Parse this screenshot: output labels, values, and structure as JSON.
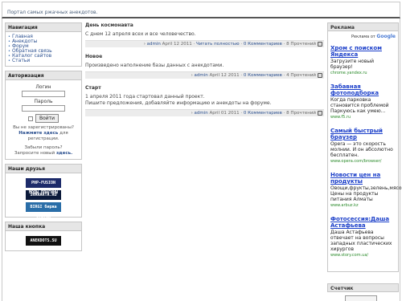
{
  "header": {
    "title": "Портал самых ржачных анекдотов."
  },
  "navigation": {
    "caption": "Навигация",
    "items": [
      "Главная",
      "Анекдоты",
      "Форум",
      "Обратная связь",
      "Каталог сайтов",
      "Статьи"
    ]
  },
  "auth": {
    "caption": "Авторизация",
    "login_label": "Логин",
    "password_label": "Пароль",
    "button": "Войти",
    "not_registered": "Вы не зарегистрированы?",
    "click_here": "Нажмите здесь",
    "for_registration": "для регистрации.",
    "forgot": "Забыли пароль?",
    "request_new": "Запросите новый",
    "here": "здесь."
  },
  "friends": {
    "caption": "Наши друзья",
    "banners": [
      "PHP-FUSION МОДЫ ПЛАГИНЫ",
      "SHARARTA.RU",
      "BIRGI биржа статей"
    ]
  },
  "our_button": {
    "caption": "Наша кнопка",
    "banner": "ANEKDOTS.SU"
  },
  "news": [
    {
      "title": "День космонавта",
      "text": "С днем 12 апреля всех и все человечество.",
      "author": "admin",
      "date": "April 12 2011",
      "read_more": "Читать полностью",
      "comments": "0 Комментариев",
      "reads": "8 Прочтений"
    },
    {
      "title": "Новое",
      "text": "Произведено наполнение базы данных с анекдотами.",
      "author": "admin",
      "date": "April 12 2011",
      "read_more": "",
      "comments": "0 Комментариев",
      "reads": "4 Прочтений"
    },
    {
      "title": "Старт",
      "text": "1 апреля 2011 года стартовал данный проект.",
      "text2": "Пишите предложения, добавляйте информацию и анекдоты на форуме.",
      "author": "admin",
      "date": "April 01 2011",
      "read_more": "",
      "comments": "0 Комментариев",
      "reads": "8 Прочтений"
    }
  ],
  "ads": {
    "caption": "Реклама",
    "ads_by": "Реклама от",
    "google": "Google",
    "items": [
      {
        "title": "Хром с поиском Яндекса",
        "text": "Загрузите новый браузер!",
        "url": "chrome.yandex.ru"
      },
      {
        "title": "Забавная фотоподборка",
        "text": "Когда парковка становится проблемой Паркуюсь как умею...",
        "url": "www.f5.ru"
      },
      {
        "title": "Самый быстрый браузер",
        "text": "Opera — это скорость молнии. И он абсолютно бесплатен.",
        "url": "www.opera.com/browser/"
      },
      {
        "title": "Новости цен на продукты",
        "text": "Овощи,фрукты,зелень,мясо... Цены на продукты питания Алматы",
        "url": "www.arbuz.kz"
      },
      {
        "title": "Фотосессия:Даша Астафьева",
        "text": "Даша Астафьева отвечает на вопросы западных пластических хирургов",
        "url": "www.story.com.ua/"
      }
    ]
  },
  "counter": {
    "caption": "Счетчик"
  },
  "colors": {
    "link": "#2a4f8f",
    "ad_title": "#1a3ec9",
    "ad_url": "#2a8a2a",
    "panel_caption_bg": "#e6e6e6"
  }
}
